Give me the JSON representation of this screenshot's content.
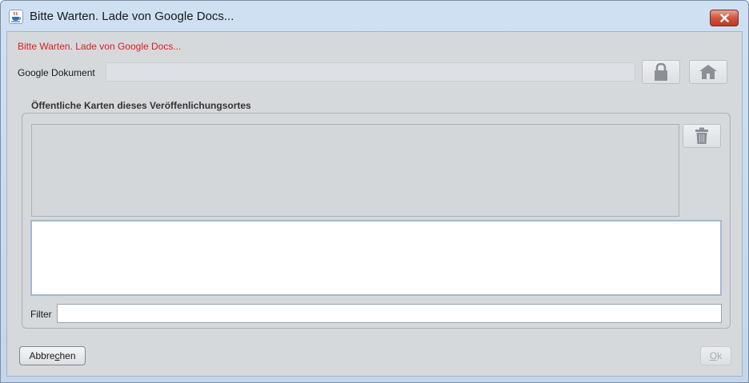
{
  "window": {
    "title": "Bitte Warten. Lade von Google Docs...",
    "app_icon": "java-cup-icon",
    "close_icon": "close-icon"
  },
  "status_message": "Bitte Warten. Lade von Google Docs...",
  "google_document": {
    "label": "Google Dokument",
    "value": "",
    "lock_icon": "lock-icon",
    "home_icon": "home-icon"
  },
  "public_maps": {
    "title": "Öffentliche Karten dieses Veröffenlichungsortes",
    "delete_icon": "trash-icon",
    "filter_label": "Filter",
    "filter_value": ""
  },
  "buttons": {
    "cancel_pre": "Abbre",
    "cancel_mnemonic": "c",
    "cancel_post": "hen",
    "ok_mnemonic": "O",
    "ok_post": "k"
  },
  "colors": {
    "status_text": "#d81e1e",
    "dialog_background": "#d6d9dc"
  }
}
